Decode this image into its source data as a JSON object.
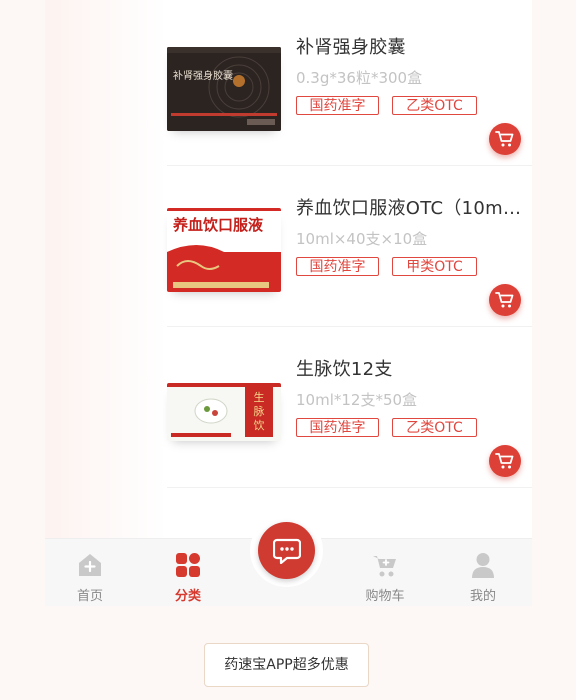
{
  "products": [
    {
      "name": "补肾强身胶囊",
      "spec": "0.3g*36粒*300盒",
      "tags": [
        "国药准字",
        "乙类OTC"
      ],
      "box_text": "补肾强身胶囊"
    },
    {
      "name": "养血饮口服液OTC（10ml...",
      "spec": "10ml×40支×10盒",
      "tags": [
        "国药准字",
        "甲类OTC"
      ],
      "box_text": "养血饮口服液"
    },
    {
      "name": "生脉饮12支",
      "spec": "10ml*12支*50盒",
      "tags": [
        "国药准字",
        "乙类OTC"
      ],
      "box_text": "生脉饮"
    }
  ],
  "tabbar": {
    "home": "首页",
    "category": "分类",
    "cart": "购物车",
    "mine": "我的"
  },
  "promo": "药速宝APP超多优惠",
  "colors": {
    "accent": "#dd4037",
    "active_tab": "#d63a2f",
    "muted": "#c3c3c3"
  }
}
